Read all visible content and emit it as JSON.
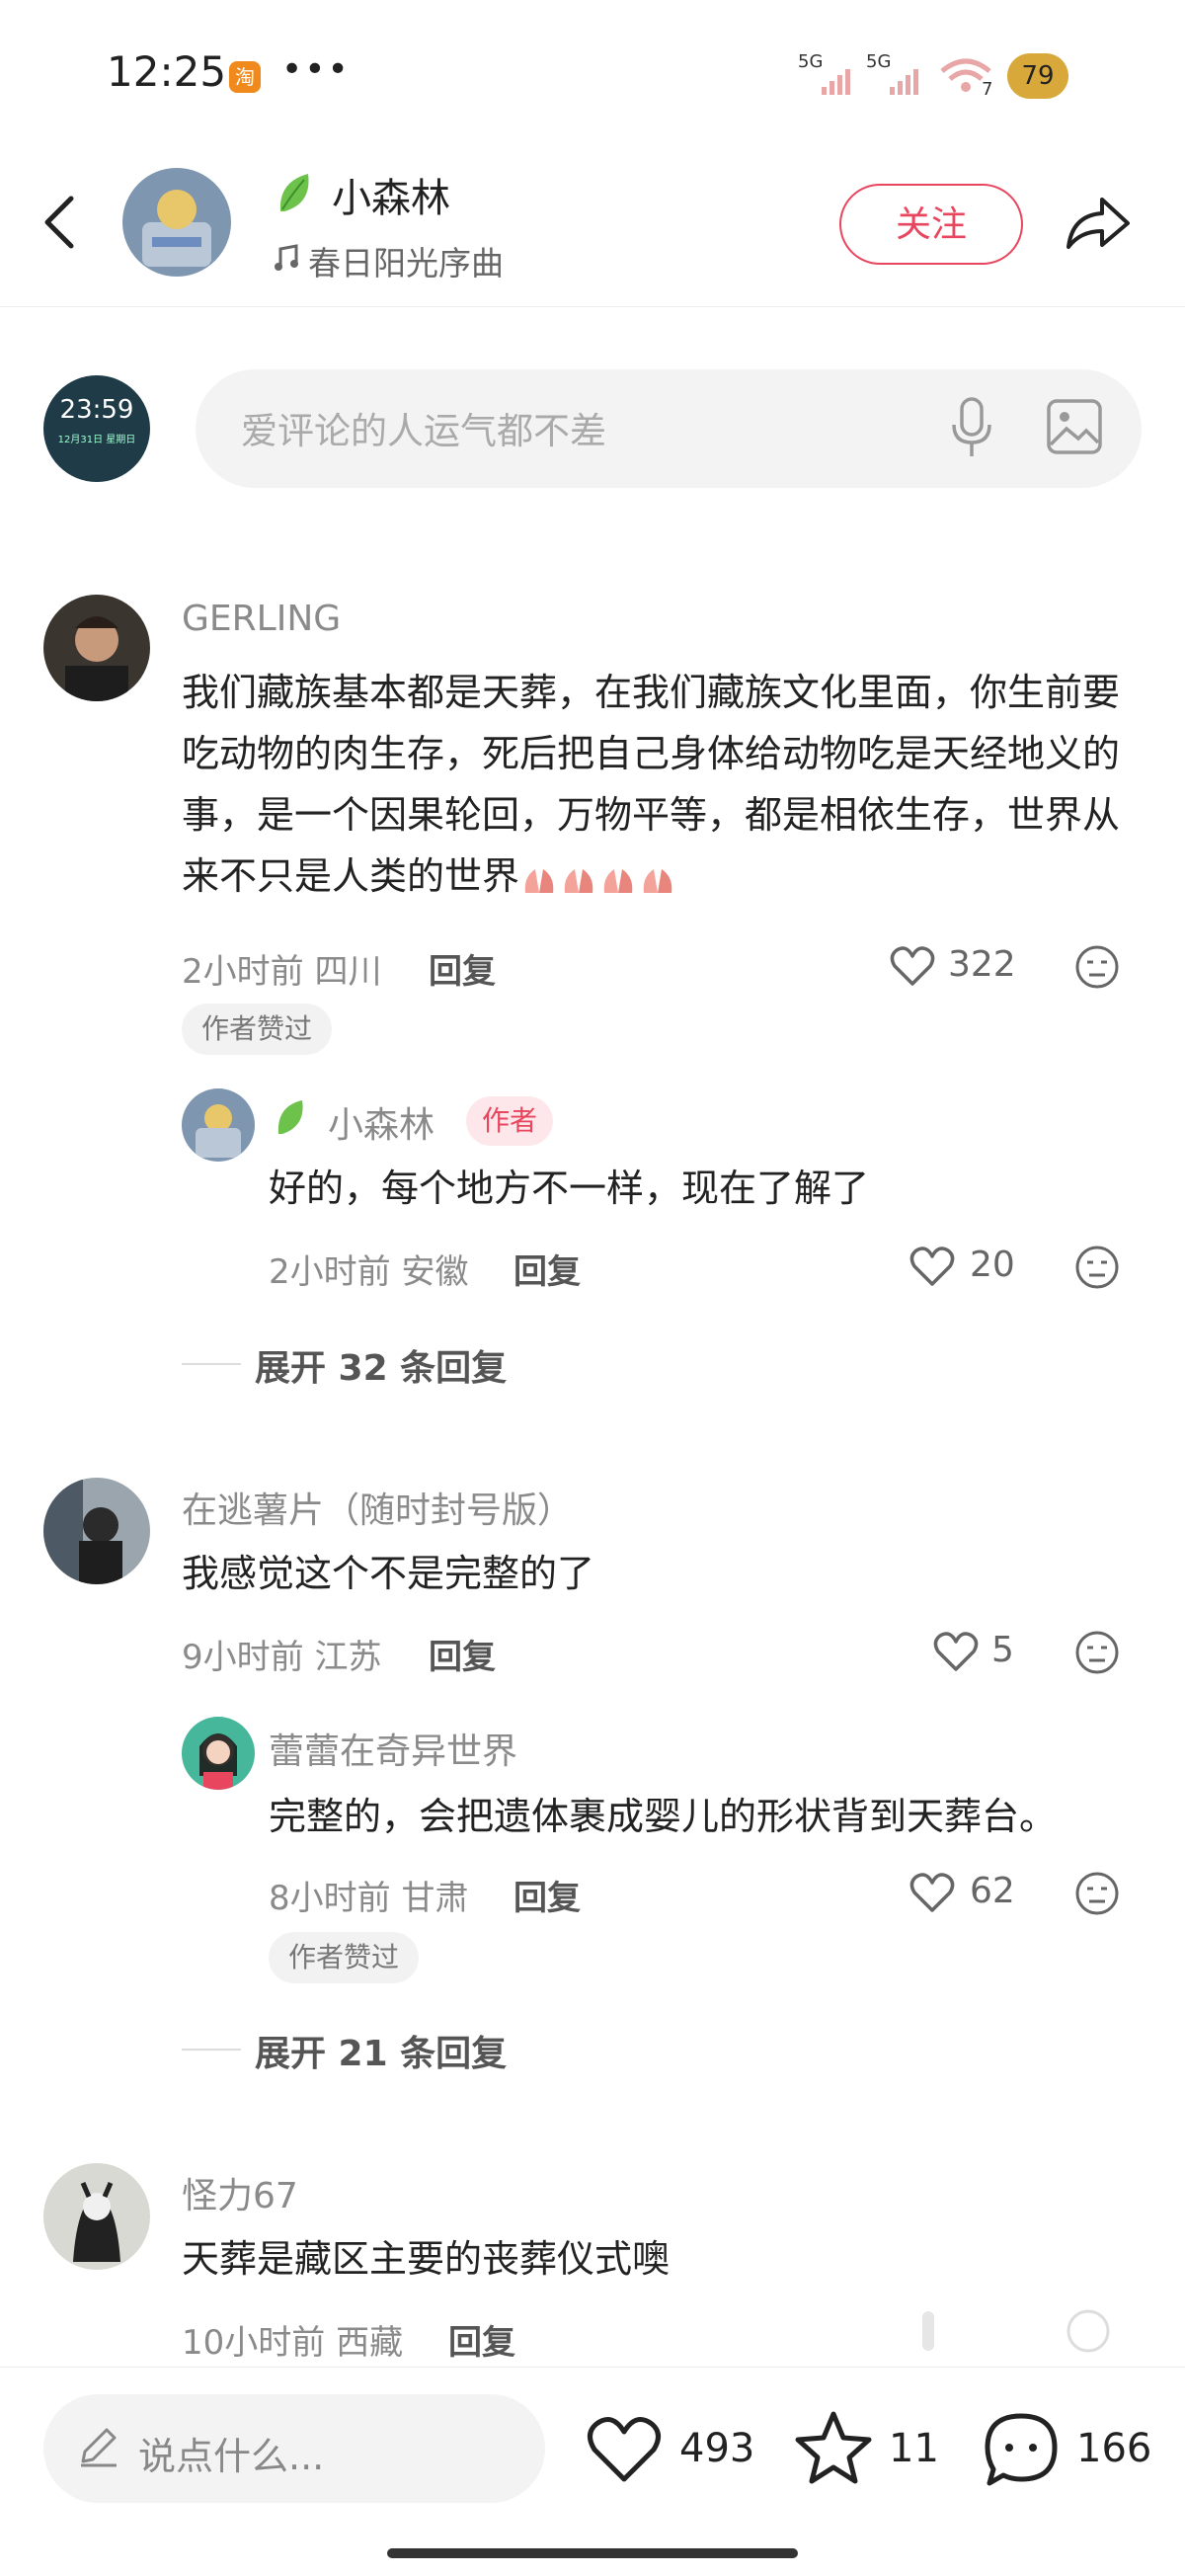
{
  "status_bar": {
    "time": "12:25",
    "taobao_glyph": "淘",
    "more": "•••",
    "signal1_label": "5G",
    "signal2_label": "5G",
    "wifi_sub": "7",
    "battery": "79"
  },
  "header": {
    "author_name": "小森林",
    "music": "春日阳光序曲",
    "follow_label": "关注"
  },
  "comment_input": {
    "placeholder": "爱评论的人运气都不差",
    "avatar_time": "23:59",
    "avatar_date": "12月31日 星期日"
  },
  "comments": [
    {
      "user": "GERLING",
      "text": "我们藏族基本都是天葬，在我们藏族文化里面，你生前要吃动物的肉生存，死后把自己身体给动物吃是天经地义的事，是一个因果轮回，万物平等，都是相依生存，世界从来不只是人类的世界",
      "meta": "2小时前 四川",
      "reply_label": "回复",
      "likes": "322",
      "badge": "作者赞过",
      "sub_reply": {
        "user": "小森林",
        "tag": "作者",
        "text": "好的，每个地方不一样，现在了解了",
        "meta": "2小时前 安徽",
        "reply_label": "回复",
        "likes": "20"
      },
      "expand": "展开 32 条回复"
    },
    {
      "user": "在逃薯片（随时封号版）",
      "text": "我感觉这个不是完整的了",
      "meta": "9小时前 江苏",
      "reply_label": "回复",
      "likes": "5",
      "sub_reply": {
        "user": "蕾蕾在奇异世界",
        "text": "完整的，会把遗体裹成婴儿的形状背到天葬台。",
        "meta": "8小时前 甘肃",
        "reply_label": "回复",
        "likes": "62",
        "badge": "作者赞过"
      },
      "expand": "展开 21 条回复"
    },
    {
      "user": "怪力67",
      "text": "天葬是藏区主要的丧葬仪式噢",
      "meta": "10小时前 西藏",
      "reply_label": "回复"
    }
  ],
  "bottom_bar": {
    "placeholder": "说点什么...",
    "likes": "493",
    "favorites": "11",
    "comments": "166"
  },
  "colors": {
    "accent": "#e7465e",
    "muted_text": "#8a8a8a",
    "input_bg": "#f3f3f3",
    "leaf_green": "#6cc24a"
  }
}
